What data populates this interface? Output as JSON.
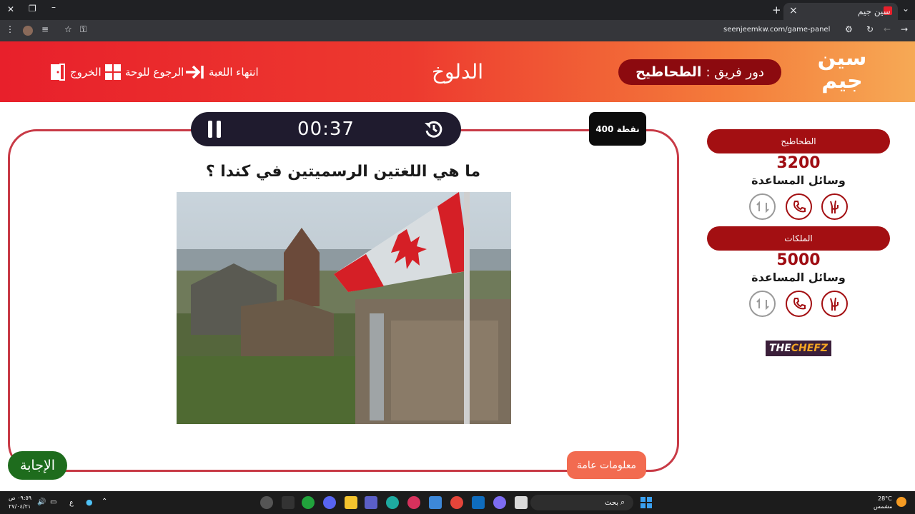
{
  "browser": {
    "tab_title": "سين جيم",
    "url": "seenjeemkw.com/game-panel",
    "new_tab": "+",
    "close_tab": "×"
  },
  "header": {
    "logo_line1": "سين",
    "logo_line2": "جيم",
    "turn_label": "دور فريق :",
    "turn_team": "الطحاطيح",
    "game_title": "الدلوخ",
    "end_game": "انتهاء اللعبة",
    "back_to_board": "الرجوع للوحة",
    "exit": "الخروج"
  },
  "question_panel": {
    "timer": "00:37",
    "points": "400 نقطة",
    "question": "ما هي اللغتين الرسميتين في كندا ؟",
    "category": "معلومات عامة",
    "answer_button": "الإجابة"
  },
  "teams": [
    {
      "name": "الطحاطيح",
      "score": "3200",
      "aids_label": "وسائل المساعدة"
    },
    {
      "name": "الملكات",
      "score": "5000",
      "aids_label": "وسائل المساعدة"
    }
  ],
  "sponsor": {
    "part1": "THE ",
    "part2": "CHEFZ"
  },
  "taskbar": {
    "weather_temp": "28°C",
    "weather_desc": "مشمس",
    "search_placeholder": "بحث",
    "time": "٠٩:٥٩ ص",
    "date": "٢٧/٠٤/٢١",
    "lang": "ع"
  },
  "colors": {
    "header_red": "#e8202b",
    "header_orange": "#f6a955",
    "team_red": "#a30f12",
    "answer_green": "#1e6c1d",
    "category_orange": "#f26b50",
    "timer_dark": "#1f1b2e"
  }
}
